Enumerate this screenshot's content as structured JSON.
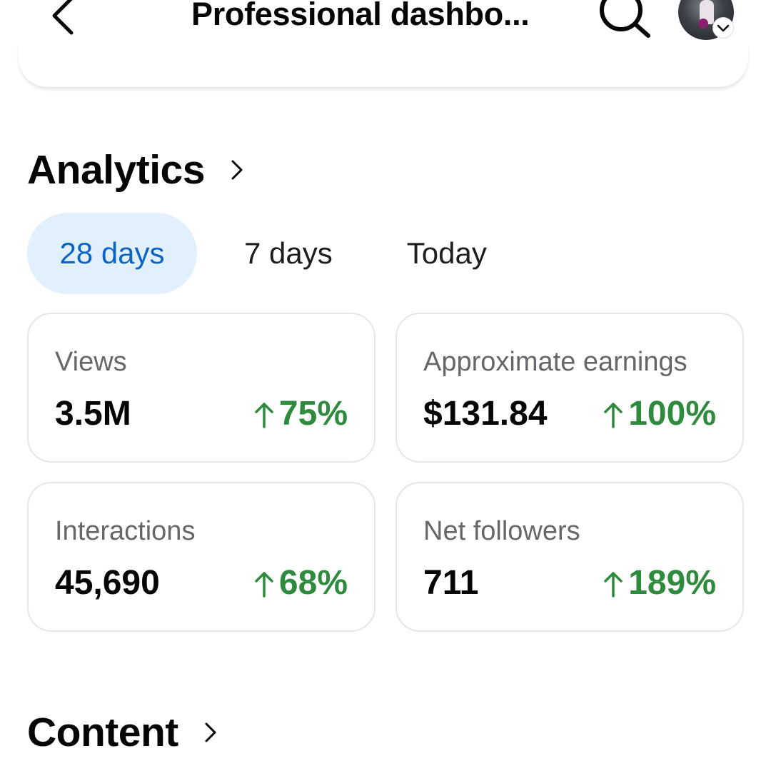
{
  "header": {
    "title": "Professional dashbo...",
    "back_icon": "chevron-left-icon",
    "search_icon": "search-icon",
    "avatar_icon": "profile-avatar"
  },
  "analytics": {
    "title": "Analytics",
    "tabs": [
      {
        "label": "28 days",
        "active": true
      },
      {
        "label": "7 days",
        "active": false
      },
      {
        "label": "Today",
        "active": false
      }
    ],
    "metrics": [
      {
        "label": "Views",
        "value": "3.5M",
        "change": "75%"
      },
      {
        "label": "Approximate earnings",
        "value": "$131.84",
        "change": "100%"
      },
      {
        "label": "Interactions",
        "value": "45,690",
        "change": "68%"
      },
      {
        "label": "Net followers",
        "value": "711",
        "change": "189%"
      }
    ]
  },
  "content": {
    "title": "Content"
  },
  "colors": {
    "accent": "#0a66c2",
    "accent_bg": "#e2effd",
    "positive": "#2e8b3e",
    "muted_text": "#65676b",
    "card_border": "#e4e6eb"
  }
}
